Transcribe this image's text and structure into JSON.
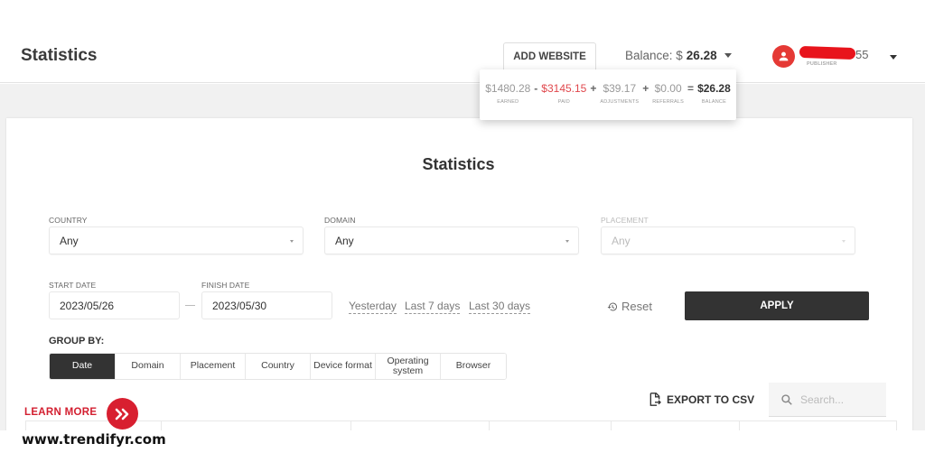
{
  "header": {
    "title": "Statistics",
    "add_website_label": "ADD WEBSITE",
    "balance_label": "Balance: $",
    "balance_amount": "26.28",
    "user": {
      "name_suffix": "55",
      "role": "PUBLISHER"
    }
  },
  "balance_breakdown": {
    "earned": {
      "value": "$1480.28",
      "label": "EARNED"
    },
    "paid": {
      "value": "$3145.15",
      "label": "PAID"
    },
    "adjustments": {
      "value": "$39.17",
      "label": "ADJUSTMENTS"
    },
    "referrals": {
      "value": "$0.00",
      "label": "REFERRALS"
    },
    "balance": {
      "value": "$26.28",
      "label": "BALANCE"
    },
    "operators": [
      "-",
      "+",
      "+",
      "="
    ],
    "colors": {
      "paid": "#e0474c"
    }
  },
  "main": {
    "title": "Statistics",
    "filters": {
      "country": {
        "label": "COUNTRY",
        "value": "Any"
      },
      "domain": {
        "label": "DOMAIN",
        "value": "Any"
      },
      "placement": {
        "label": "PLACEMENT",
        "value": "Any",
        "disabled": true
      }
    },
    "dates": {
      "start_label": "START DATE",
      "start_value": "2023/05/26",
      "finish_label": "FINISH DATE",
      "finish_value": "2023/05/30",
      "quick_links": [
        "Yesterday",
        "Last 7 days",
        "Last 30 days"
      ]
    },
    "reset_label": "Reset",
    "apply_label": "APPLY",
    "group_by": {
      "label": "GROUP BY:",
      "options": [
        "Date",
        "Domain",
        "Placement",
        "Country",
        "Device format",
        "Operating system",
        "Browser"
      ],
      "active": "Date"
    },
    "export_label": "EXPORT TO CSV",
    "search_placeholder": "Search..."
  },
  "overlay": {
    "learn_more": "LEARN MORE",
    "website": "www.trendifyr.com",
    "brand_color": "#d81f30"
  }
}
